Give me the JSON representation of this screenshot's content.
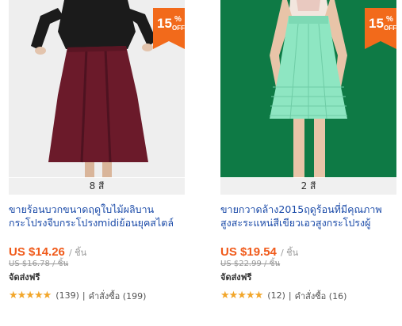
{
  "products": [
    {
      "discount_num": "15",
      "discount_pct": "%",
      "discount_off": "OFF",
      "colors": "8 สี",
      "title_line1": "ขายร้อนบวกขนาดฤดูใบไม้ผลิบาน",
      "title_line2": "กระโปรงจีบกระโปรงmidiย้อนยุคสไตล์",
      "price": "US $14.26",
      "unit": "/ ชิ้น",
      "old_price": "US $16.78 / ชิ้น",
      "shipping": "จัดส่งฟรี",
      "stars": "★★★★★",
      "rating": 4.5,
      "reviews": "(139)",
      "orders_label": "คำสั่งซื้อ (199)",
      "image_bg": "#eeeeee",
      "garment_color": "#6b1a2a"
    },
    {
      "discount_num": "15",
      "discount_pct": "%",
      "discount_off": "OFF",
      "colors": "2 สี",
      "title_line1": "ขายกวาดล้าง2015ฤดูร้อนที่มีคุณภาพ",
      "title_line2": "สูงสะระแหน่สีเขียวเอวสูงกระโปรงผู้",
      "price": "US $19.54",
      "unit": "/ ชิ้น",
      "old_price": "US $22.99 / ชิ้น",
      "shipping": "จัดส่งฟรี",
      "stars": "★★★★★",
      "rating": 5,
      "reviews": "(12)",
      "orders_label": "คำสั่งซื้อ (16)",
      "image_bg": "#0e7a45",
      "garment_color": "#8ee6c2"
    }
  ],
  "colors": {
    "badge": "#f26a1b",
    "price": "#f05a1a",
    "title_link": "#1a4aa8",
    "star": "#f2a62a"
  }
}
